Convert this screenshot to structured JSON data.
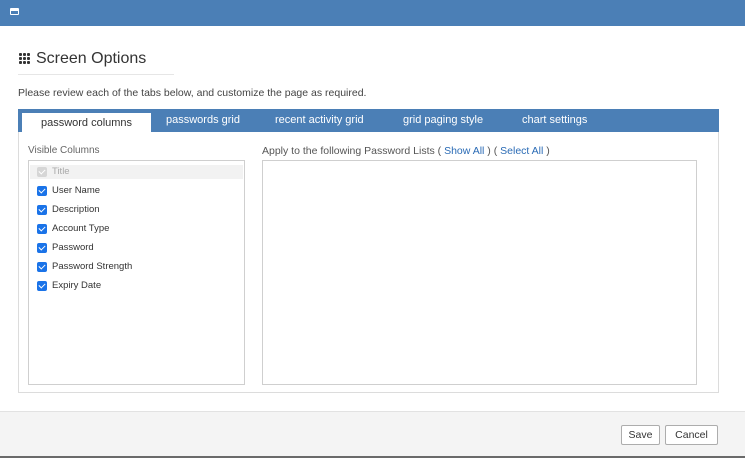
{
  "dialog": {
    "heading": "Screen Options",
    "intro": "Please review each of the tabs below, and customize the page as required."
  },
  "tabs": [
    {
      "label": "password columns",
      "active": true
    },
    {
      "label": "passwords grid",
      "active": false
    },
    {
      "label": "recent activity grid",
      "active": false
    },
    {
      "label": "grid paging style",
      "active": false
    },
    {
      "label": "chart settings",
      "active": false
    }
  ],
  "columns": {
    "label": "Visible Columns",
    "items": [
      {
        "label": "Title",
        "checked": true,
        "disabled": true
      },
      {
        "label": "User Name",
        "checked": true,
        "disabled": false
      },
      {
        "label": "Description",
        "checked": true,
        "disabled": false
      },
      {
        "label": "Account Type",
        "checked": true,
        "disabled": false
      },
      {
        "label": "Password",
        "checked": true,
        "disabled": false
      },
      {
        "label": "Password Strength",
        "checked": true,
        "disabled": false
      },
      {
        "label": "Expiry Date",
        "checked": true,
        "disabled": false
      }
    ]
  },
  "apply": {
    "prefix": "Apply to the following Password Lists (",
    "show_all": "Show All",
    "middle": ") (",
    "select_all": "Select All",
    "suffix": ")"
  },
  "footer": {
    "save_label": "Save",
    "cancel_label": "Cancel"
  },
  "colors": {
    "accent": "#4b7fb6",
    "link": "#2a6bb5",
    "checkbox": "#1a73e8"
  }
}
